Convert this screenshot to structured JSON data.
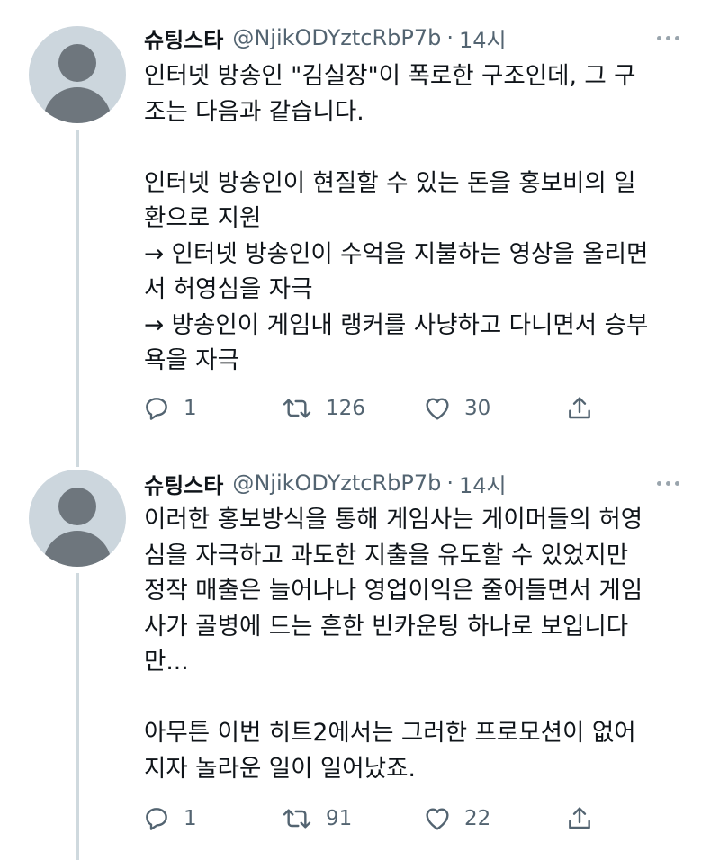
{
  "tweets": [
    {
      "name": "슈팅스타",
      "handle": "@NjikODYztcRbP7b",
      "dot": "·",
      "time": "14시",
      "text": "인터넷 방송인 \"김실장\"이 폭로한 구조인데, 그 구\n조는 다음과 같습니다.\n\n인터넷 방송인이 현질할 수 있는 돈을 홍보비의 일\n환으로 지원\n→ 인터넷 방송인이 수억을 지불하는 영상을 올리면\n서 허영심을 자극\n→ 방송인이 게임내 랭커를 사냥하고 다니면서 승부\n욕을 자극",
      "replies": "1",
      "retweets": "126",
      "likes": "30"
    },
    {
      "name": "슈팅스타",
      "handle": "@NjikODYztcRbP7b",
      "dot": "·",
      "time": "14시",
      "text": "이러한 홍보방식을 통해 게임사는 게이머들의 허영\n심을 자극하고 과도한 지출을 유도할 수 있었지만\n정작 매출은 늘어나나 영업이익은 줄어들면서 게임\n사가 골병에 드는 흔한 빈카운팅 하나로 보입니다\n만...\n\n아무튼 이번 히트2에서는 그러한 프로모션이 없어\n지자 놀라운 일이 일어났죠.",
      "replies": "1",
      "retweets": "91",
      "likes": "22"
    }
  ]
}
